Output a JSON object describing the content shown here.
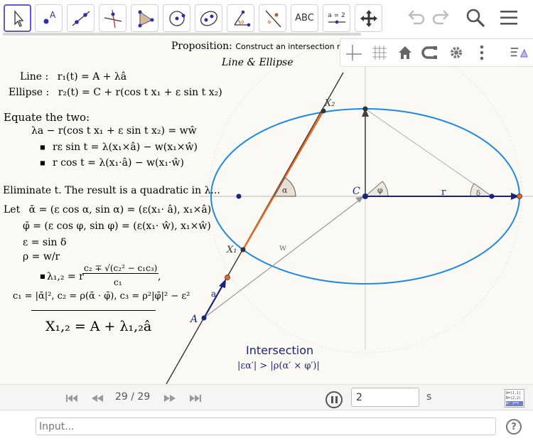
{
  "toolbar": {
    "tools": [
      {
        "name": "move-tool",
        "icon": "cursor-arrow-icon"
      },
      {
        "name": "point-tool",
        "icon": "point-icon",
        "label": "A"
      },
      {
        "name": "line-tool",
        "icon": "line-through-two-points-icon"
      },
      {
        "name": "perpendicular-line-tool",
        "icon": "perpendicular-line-icon"
      },
      {
        "name": "polygon-tool",
        "icon": "polygon-icon"
      },
      {
        "name": "circle-tool",
        "icon": "circle-center-point-icon"
      },
      {
        "name": "ellipse-tool",
        "icon": "ellipse-icon"
      },
      {
        "name": "angle-tool",
        "icon": "angle-icon"
      },
      {
        "name": "reflect-tool",
        "icon": "reflect-about-line-icon"
      },
      {
        "name": "text-tool",
        "icon": "text-icon",
        "label": "ABC"
      },
      {
        "name": "slider-tool",
        "icon": "slider-icon",
        "label": "a = 2"
      },
      {
        "name": "move-graphics-view-tool",
        "icon": "move-graphics-view-icon"
      }
    ],
    "right_icons": [
      "undo-icon",
      "redo-icon",
      "search-icon",
      "menu-icon"
    ]
  },
  "stylebar": {
    "icons": [
      "axes-icon",
      "grid-icon",
      "home-icon",
      "point-capturing-icon",
      "settings-icon",
      "more-icon",
      "style-bar-toggle-icon"
    ]
  },
  "graphics": {
    "proposition": {
      "label": "Proposition:",
      "text": "Construct an intersection ma"
    },
    "subtitle": "Line & Ellipse",
    "line_eq": {
      "label": "Line :",
      "formula": "r₁(t) = A + λâ"
    },
    "ellipse_eq": {
      "label": "Ellipse :",
      "formula": "r₂(t) = C + r(cos t x₁ + ε sin t x₂)"
    },
    "equate": {
      "heading": "Equate the two:",
      "main": "λa − r(cos t x₁ + ε sin t x₂) = wŵ",
      "bullets": [
        "rε sin t = λ(x₁×â) − w(x₁×ŵ)",
        "r cos t = λ(x₁·â) − w(x₁·ŵ)"
      ]
    },
    "eliminate": "Eliminate t. The result is a quadratic in λ...",
    "let_defs": [
      {
        "lead": "Let",
        "formula": "ᾱ = (ε cos α, sin α) = (ε(x₁· â), x₁×â)"
      },
      {
        "lead": "",
        "formula": "φ̄ = (ε cos φ, sin φ) = (ε(x₁· ŵ), x₁×ŵ)"
      },
      {
        "lead": "",
        "formula": "ε = sin δ"
      },
      {
        "lead": "",
        "formula": "ρ = w/r"
      }
    ],
    "lambda_formula": {
      "lhs": "λ₁,₂ = r",
      "numerator": "c₂ ∓ √(c₂² − c₁c₃)",
      "denominator": "c₁",
      "trail": ","
    },
    "coeffs": "c₁ = |ᾱ|²,  c₂ = ρ(ᾱ · φ̄),  c₃ = ρ²|φ̄|² − ε²",
    "result": "X₁,₂ = A + λ₁,₂â",
    "point_labels": {
      "X2": "X₂",
      "X1": "X₁",
      "C": "C",
      "A": "A",
      "a": "a",
      "w": "w",
      "r": "r",
      "alpha": "α",
      "phi": "φ",
      "delta": "δ"
    },
    "intersection": {
      "title": "Intersection",
      "condition": "|εα′| > |ρ(α′ × φ′)|"
    }
  },
  "colors": {
    "ellipse": "#1e88e5",
    "segment": "#e8681d",
    "arrow": "#1a237e",
    "point": "#1a237e",
    "intersection_text": "#1a237e",
    "background": "#fbf9f4"
  },
  "playback": {
    "frame_counter": "29 / 29",
    "speed_value": "2",
    "speed_unit": "s",
    "algebra_toggle_text": [
      "A=(1,1)",
      "B=(2,2)",
      "a: y=x"
    ]
  },
  "input": {
    "placeholder": "Input..."
  },
  "help": {
    "label": "?"
  }
}
